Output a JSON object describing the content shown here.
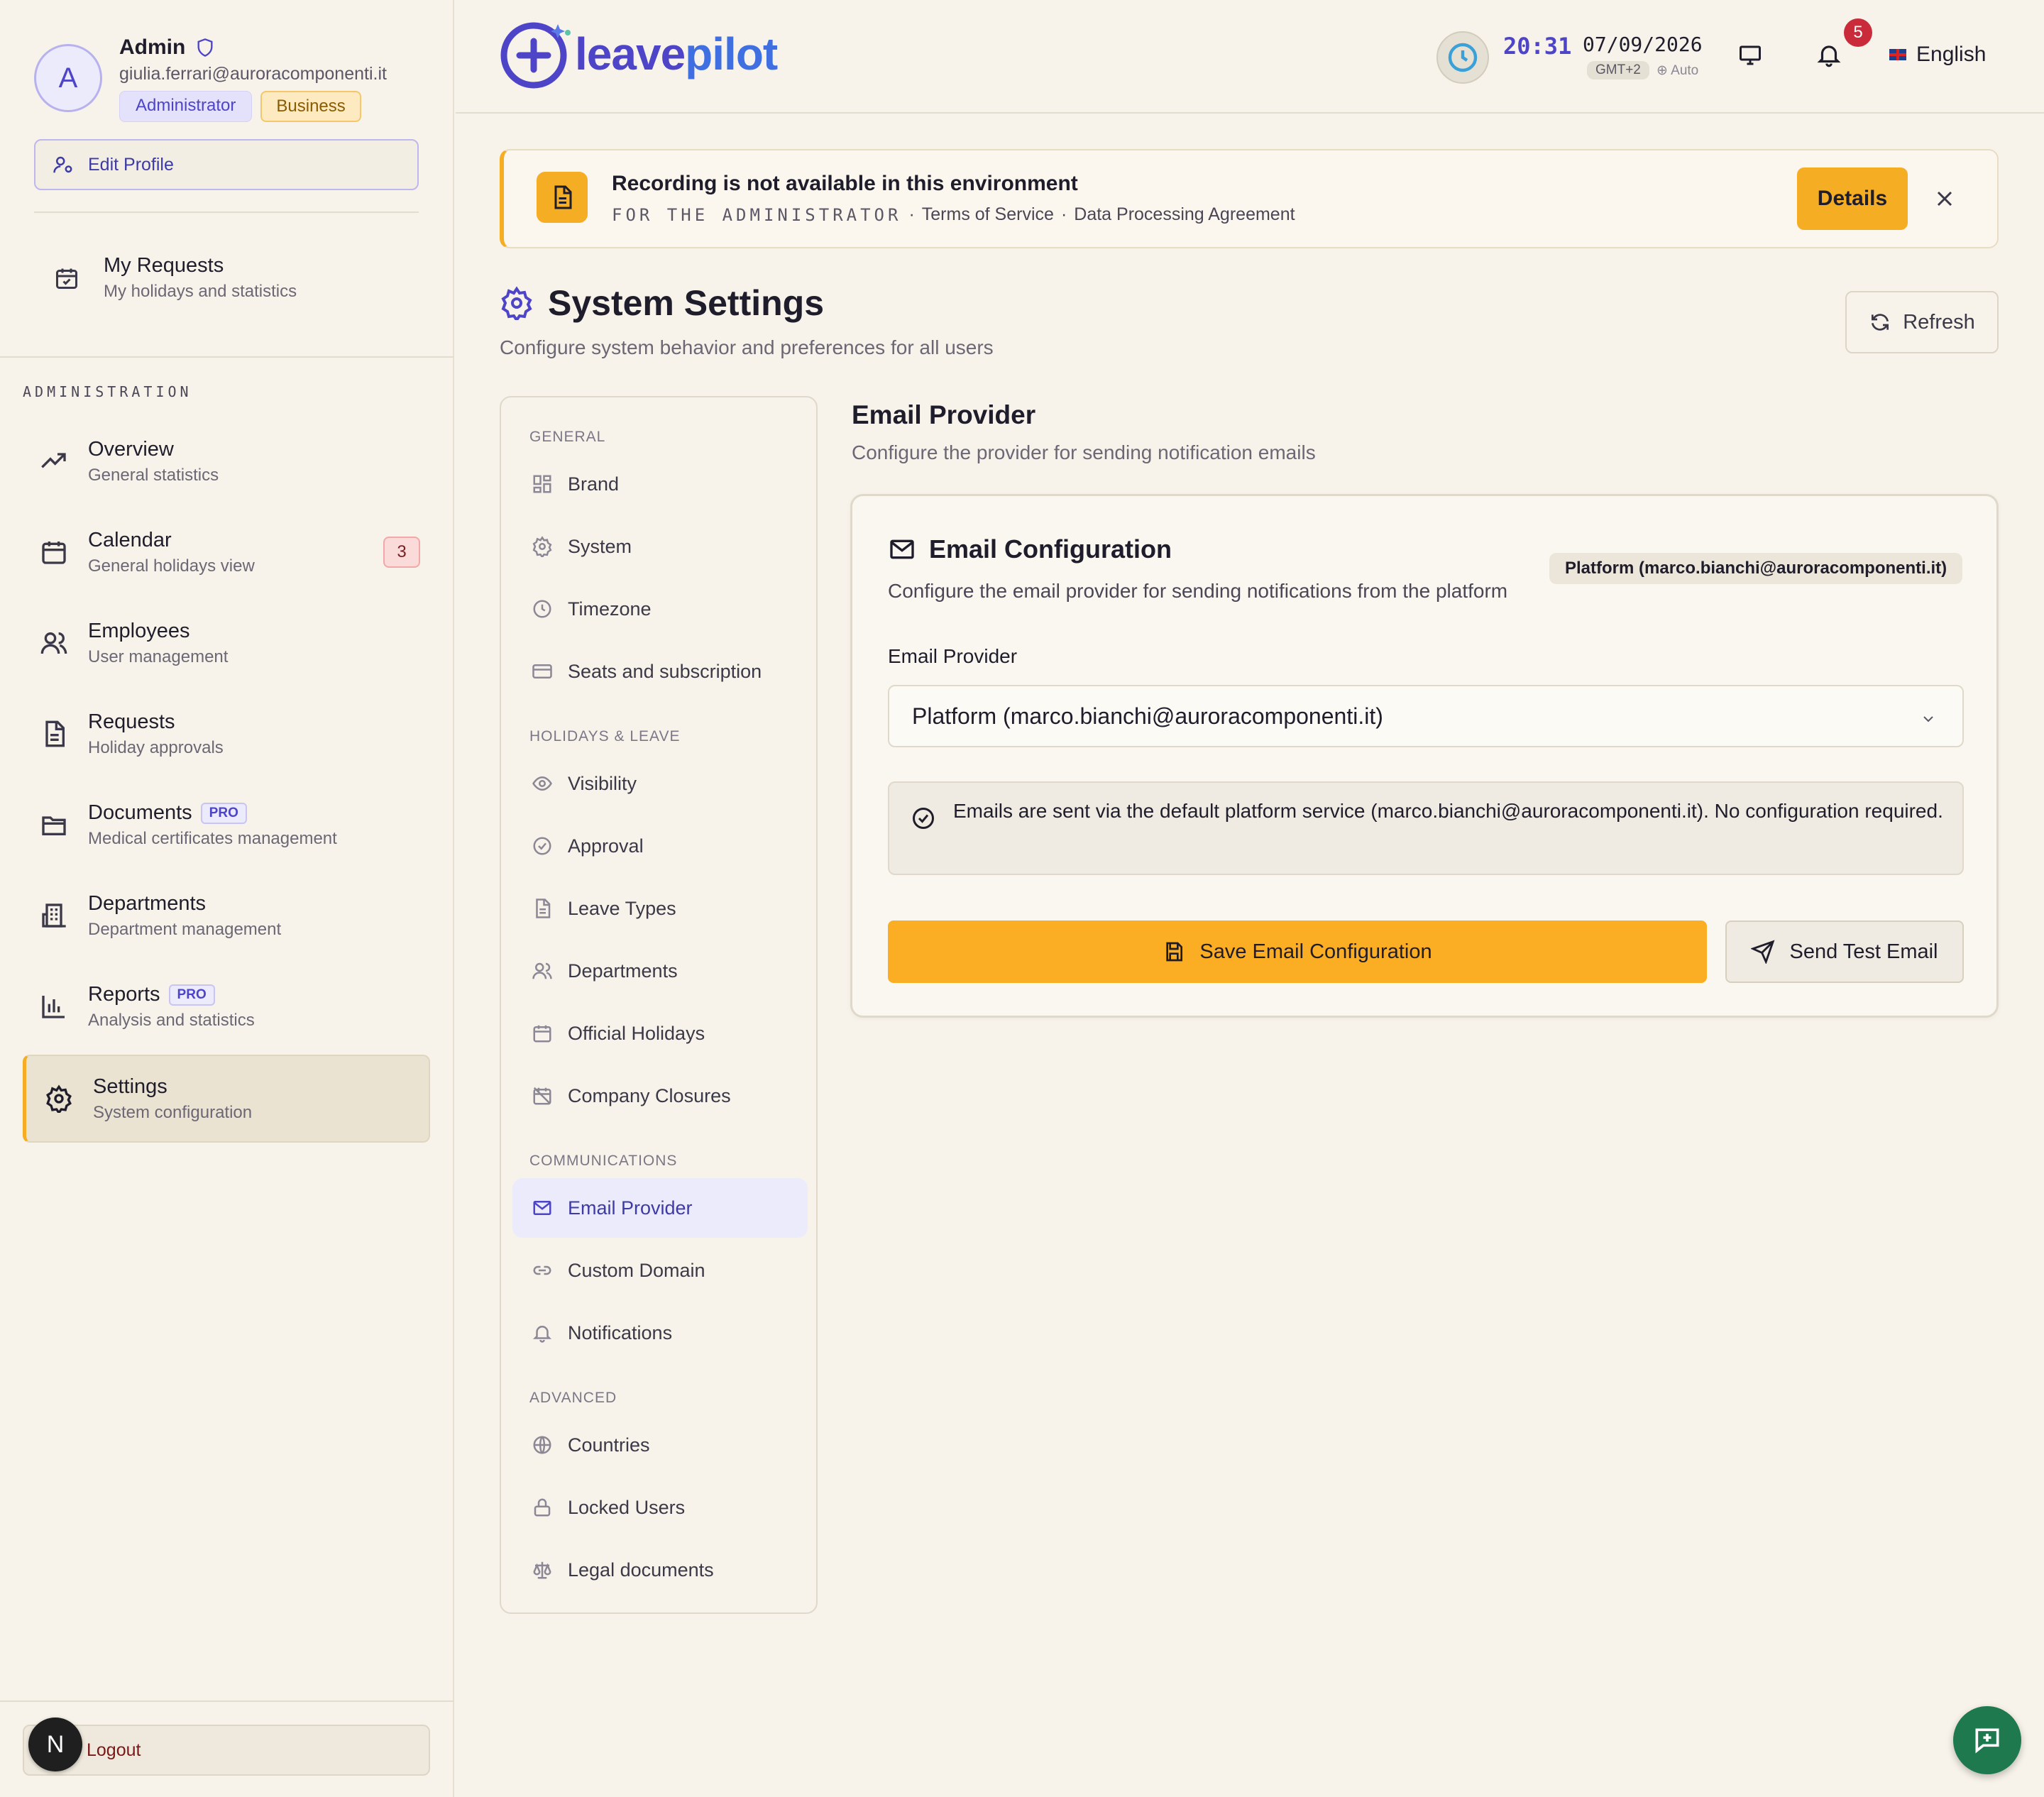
{
  "user": {
    "avatar_initial": "A",
    "name": "Admin",
    "email": "giulia.ferrari@auroracomponenti.it",
    "role_badge": "Administrator",
    "plan_badge": "Business",
    "edit_profile_label": "Edit Profile"
  },
  "sidebar": {
    "my_requests": {
      "title": "My Requests",
      "subtitle": "My holidays and statistics"
    },
    "section_label": "ADMINISTRATION",
    "items": [
      {
        "title": "Overview",
        "subtitle": "General statistics",
        "icon": "trending-up-icon"
      },
      {
        "title": "Calendar",
        "subtitle": "General holidays view",
        "icon": "calendar-icon",
        "count": "3"
      },
      {
        "title": "Employees",
        "subtitle": "User management",
        "icon": "users-icon"
      },
      {
        "title": "Requests",
        "subtitle": "Holiday approvals",
        "icon": "document-icon"
      },
      {
        "title": "Documents",
        "subtitle": "Medical certificates management",
        "icon": "folder-icon",
        "tag": "PRO"
      },
      {
        "title": "Departments",
        "subtitle": "Department management",
        "icon": "building-icon"
      },
      {
        "title": "Reports",
        "subtitle": "Analysis and statistics",
        "icon": "bar-chart-icon",
        "tag": "PRO"
      },
      {
        "title": "Settings",
        "subtitle": "System configuration",
        "icon": "gear-icon",
        "active": true
      }
    ],
    "logout_label": "Logout",
    "bottom_avatar": "N"
  },
  "topbar": {
    "logo_part1": "leave",
    "logo_part2": "pilot",
    "time": "20:31",
    "date": "07/09/2026",
    "timezone": "GMT+2",
    "tz_mode": "⊕ Auto",
    "notification_count": "5",
    "language": "English"
  },
  "banner": {
    "title": "Recording is not available in this environment",
    "audience": "FOR THE ADMINISTRATOR",
    "sep1": "·",
    "link1": "Terms of Service",
    "sep2": "·",
    "link2": "Data Processing Agreement",
    "details_label": "Details"
  },
  "page": {
    "title": "System Settings",
    "subtitle": "Configure system behavior and preferences for all users",
    "refresh_label": "Refresh"
  },
  "settings_nav": {
    "general_label": "GENERAL",
    "general": [
      "Brand",
      "System",
      "Timezone",
      "Seats and subscription"
    ],
    "holidays_label": "HOLIDAYS & LEAVE",
    "holidays": [
      "Visibility",
      "Approval",
      "Leave Types",
      "Departments",
      "Official Holidays",
      "Company Closures"
    ],
    "communications_label": "COMMUNICATIONS",
    "communications": [
      "Email Provider",
      "Custom Domain",
      "Notifications"
    ],
    "advanced_label": "ADVANCED",
    "advanced": [
      "Countries",
      "Locked Users",
      "Legal documents"
    ],
    "active": "Email Provider"
  },
  "email_provider": {
    "title": "Email Provider",
    "subtitle": "Configure the provider for sending notification emails",
    "card_title": "Email Configuration",
    "card_subtitle": "Configure the email provider for sending notifications from the platform",
    "current_pill": "Platform (marco.bianchi@auroracomponenti.it)",
    "field_label": "Email Provider",
    "selected_option": "Platform (marco.bianchi@auroracomponenti.it)",
    "info_text": "Emails are sent via the default platform service (marco.bianchi@auroracomponenti.it). No configuration required.",
    "save_label": "Save Email Configuration",
    "test_label": "Send Test Email"
  },
  "colors": {
    "accent": "#4e44c8",
    "primary_button": "#fbad23",
    "background": "#f7f3ea",
    "chat_button": "#1e7a4e",
    "danger": "#c92b3a"
  }
}
